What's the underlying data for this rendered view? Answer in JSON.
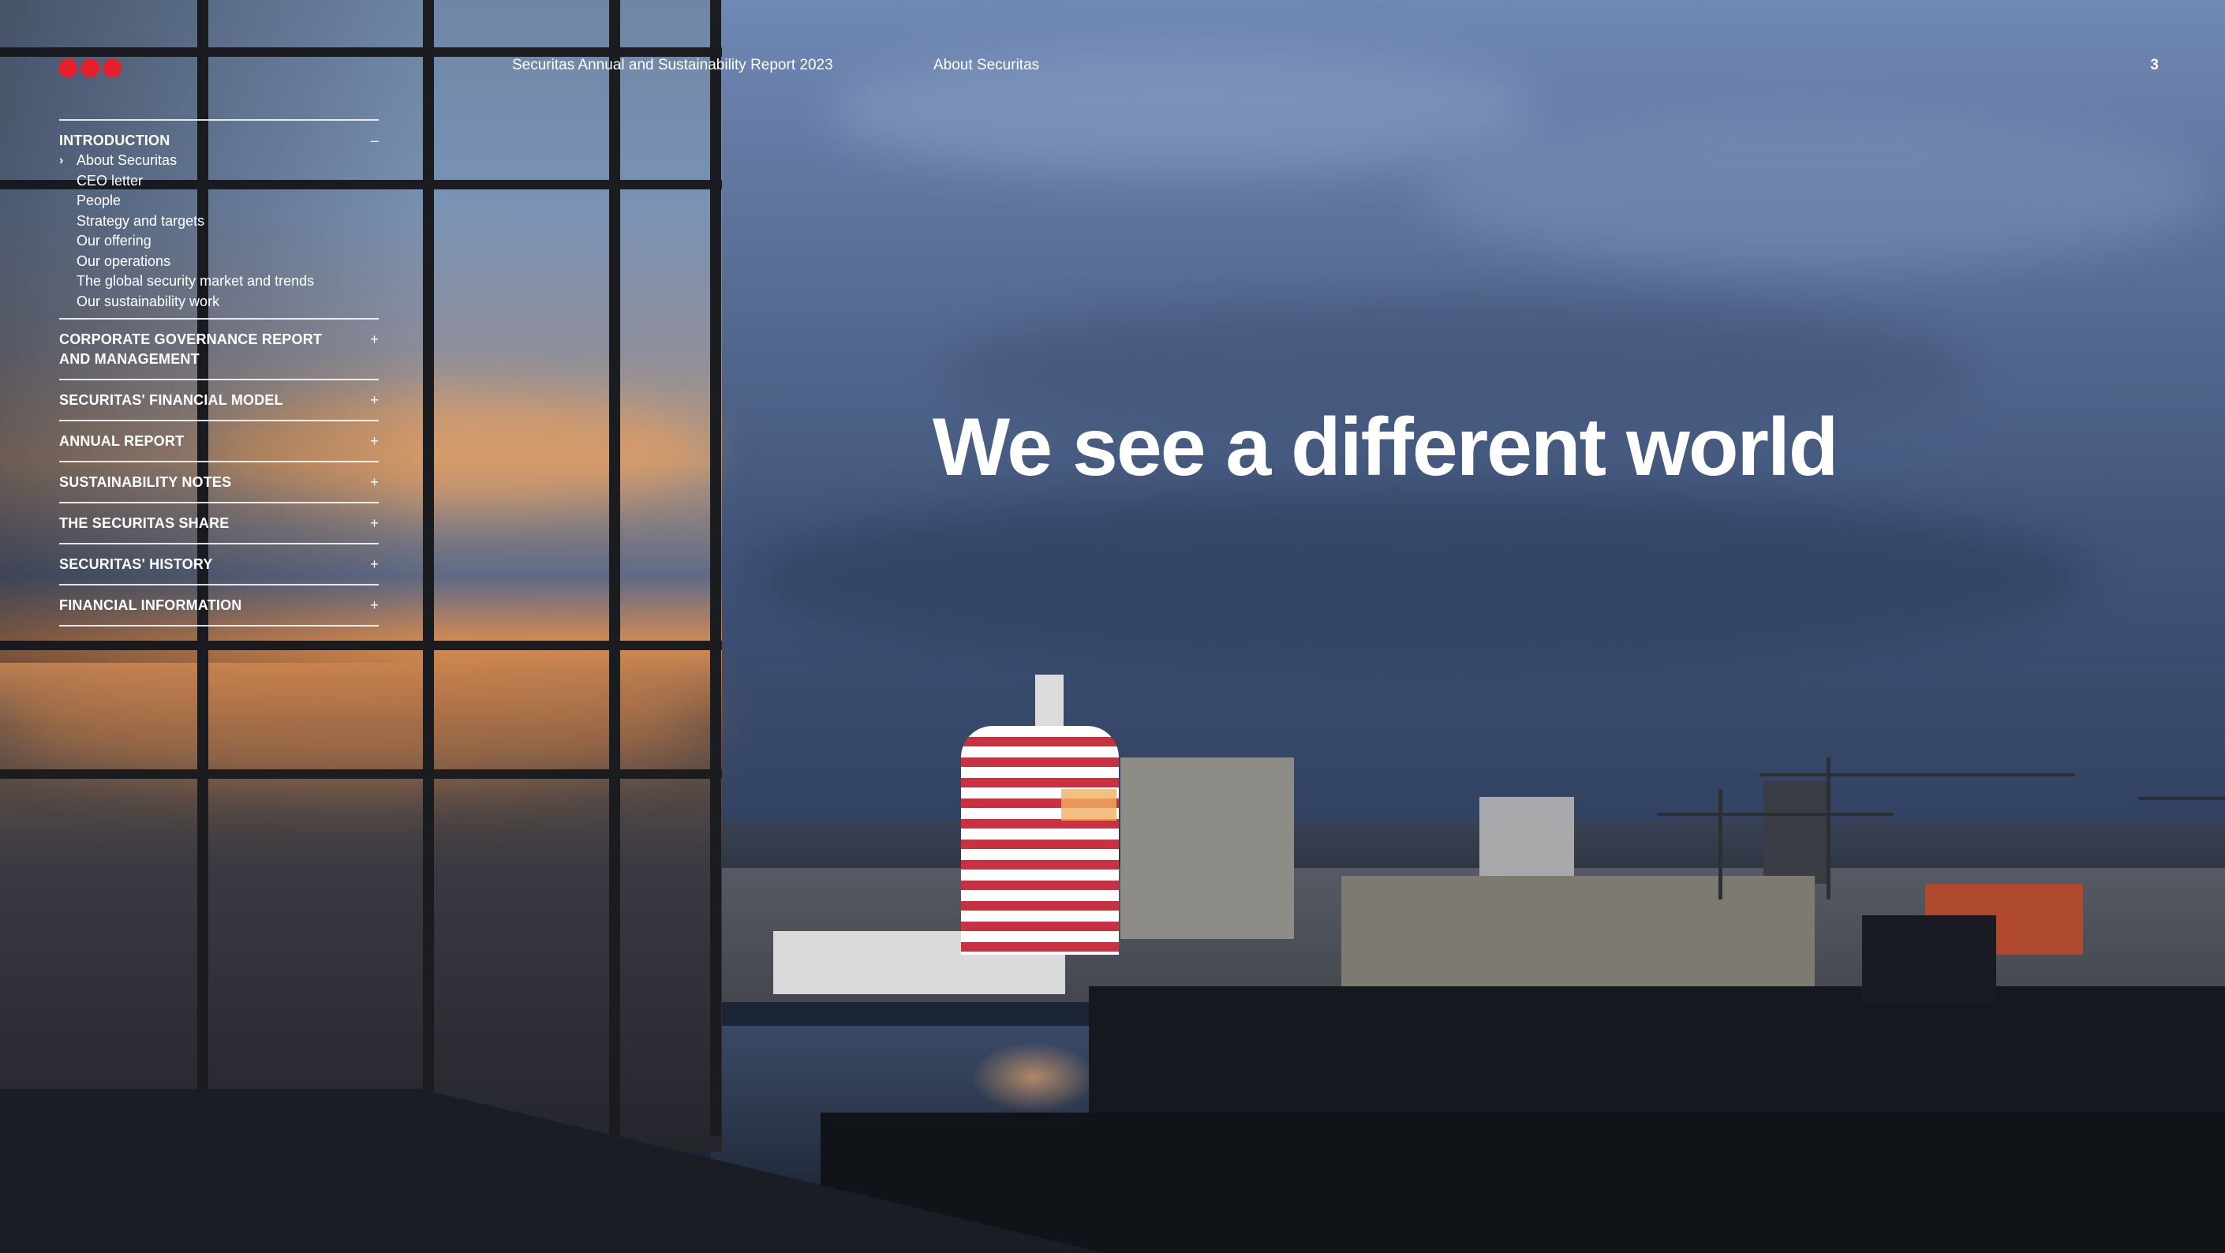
{
  "header": {
    "report_title": "Securitas Annual and Sustainability Report 2023",
    "section_title": "About Securitas",
    "page_number": "3",
    "logo_color": "#e4202f"
  },
  "nav": {
    "intro": {
      "title": "INTRODUCTION",
      "toggle": "–",
      "items": [
        "About Securitas",
        "CEO letter",
        "People",
        "Strategy and targets",
        "Our offering",
        "Our operations",
        "The global security market and trends",
        "Our sustainability work"
      ],
      "active_marker": "›"
    },
    "sections": [
      {
        "title": "CORPORATE GOVERNANCE REPORT AND MANAGEMENT",
        "toggle": "+"
      },
      {
        "title": "SECURITAS' FINANCIAL MODEL",
        "toggle": "+"
      },
      {
        "title": "ANNUAL REPORT",
        "toggle": "+"
      },
      {
        "title": "SUSTAINABILITY NOTES",
        "toggle": "+"
      },
      {
        "title": "THE SECURITAS SHARE",
        "toggle": "+"
      },
      {
        "title": "SECURITAS' HISTORY",
        "toggle": "+"
      },
      {
        "title": "FINANCIAL INFORMATION",
        "toggle": "+"
      }
    ]
  },
  "main": {
    "headline": "We see a different world"
  }
}
